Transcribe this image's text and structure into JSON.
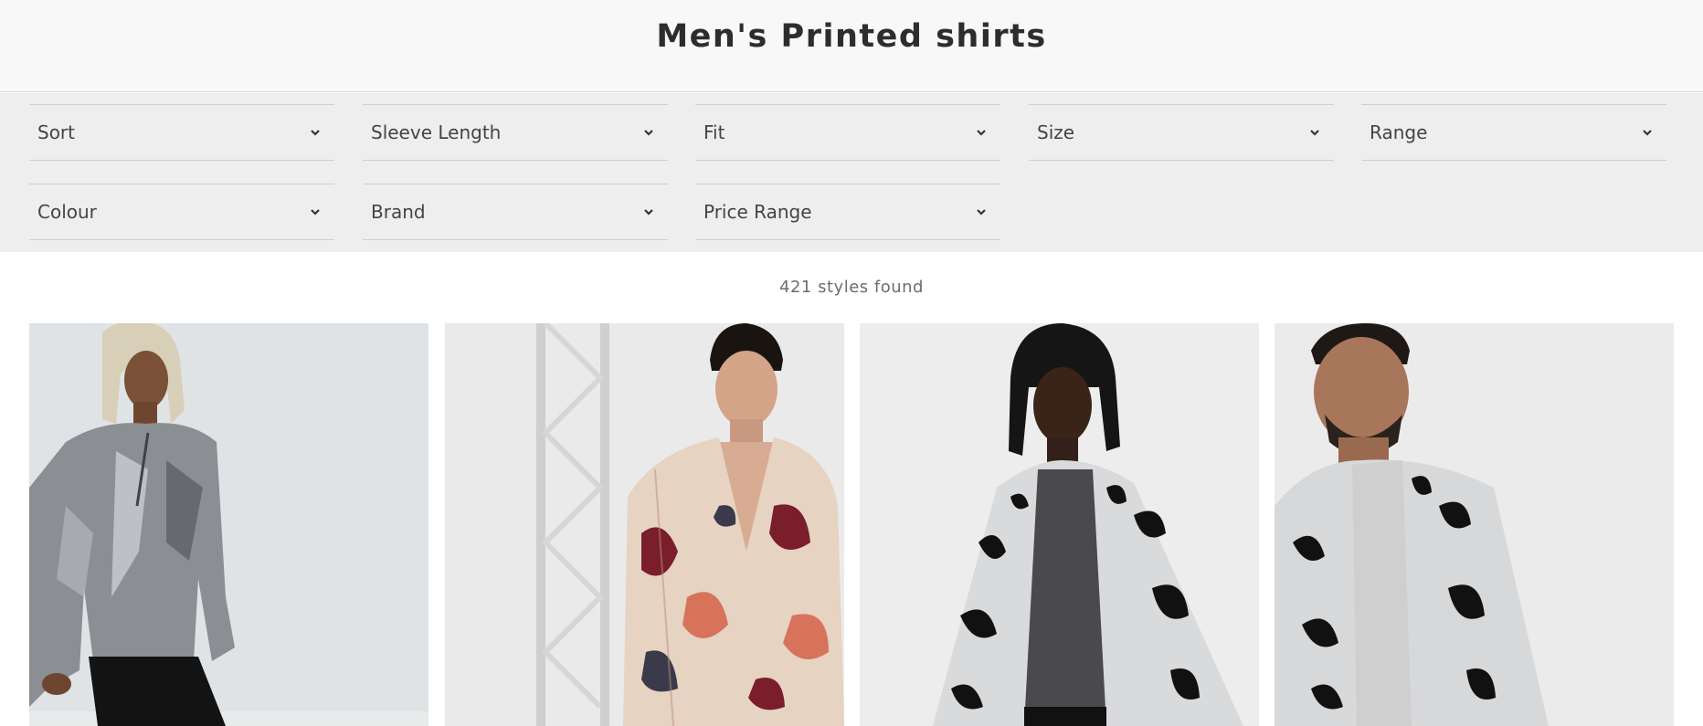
{
  "header": {
    "title": "Men's Printed shirts"
  },
  "filters": [
    {
      "label": "Sort"
    },
    {
      "label": "Sleeve Length"
    },
    {
      "label": "Fit"
    },
    {
      "label": "Size"
    },
    {
      "label": "Range"
    },
    {
      "label": "Colour"
    },
    {
      "label": "Brand"
    },
    {
      "label": "Price Range"
    }
  ],
  "results": {
    "count_text": "421 styles found"
  },
  "products": [
    {
      "image": "metallic-silver-shirt",
      "background": "#dfe3e6"
    },
    {
      "image": "paisley-print-shirt",
      "background": "#eaeaea"
    },
    {
      "image": "floral-print-shirt",
      "background": "#ededed"
    },
    {
      "image": "floral-print-shirt-plus",
      "background": "#ebebeb"
    }
  ]
}
